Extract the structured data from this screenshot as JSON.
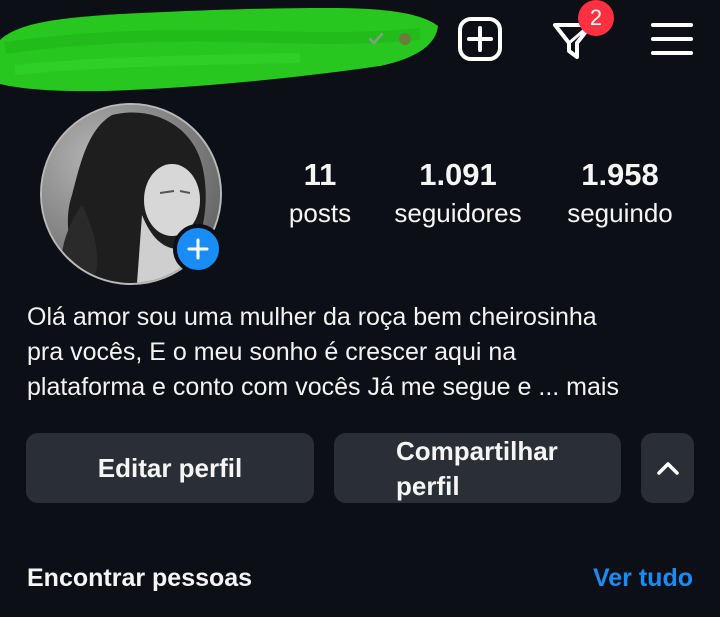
{
  "header": {
    "notification_count": "2",
    "icons": [
      "create-post-icon",
      "activity-filter-icon",
      "hamburger-menu-icon"
    ]
  },
  "profile": {
    "stats": [
      {
        "value": "11",
        "label": "posts"
      },
      {
        "value": "1.091",
        "label": "seguidores"
      },
      {
        "value": "1.958",
        "label": "seguindo"
      }
    ],
    "bio_lines": [
      "Olá amor sou uma mulher da roça bem cheirosinha",
      "pra vocês, E o meu sonho é crescer aqui na",
      "plataforma e conto com vocês Já me segue e ..."
    ],
    "bio_more": "mais"
  },
  "actions": {
    "edit_profile": "Editar perfil",
    "share_profile_line1": "Compartilhar",
    "share_profile_line2": "perfil"
  },
  "suggestions": {
    "title": "Encontrar pessoas",
    "see_all": "Ver tudo"
  },
  "colors": {
    "background": "#0c1016",
    "button": "#2a2f36",
    "accent_blue": "#1a8cf5",
    "badge_red": "#ff3040",
    "redaction_green": "#28c71f"
  }
}
